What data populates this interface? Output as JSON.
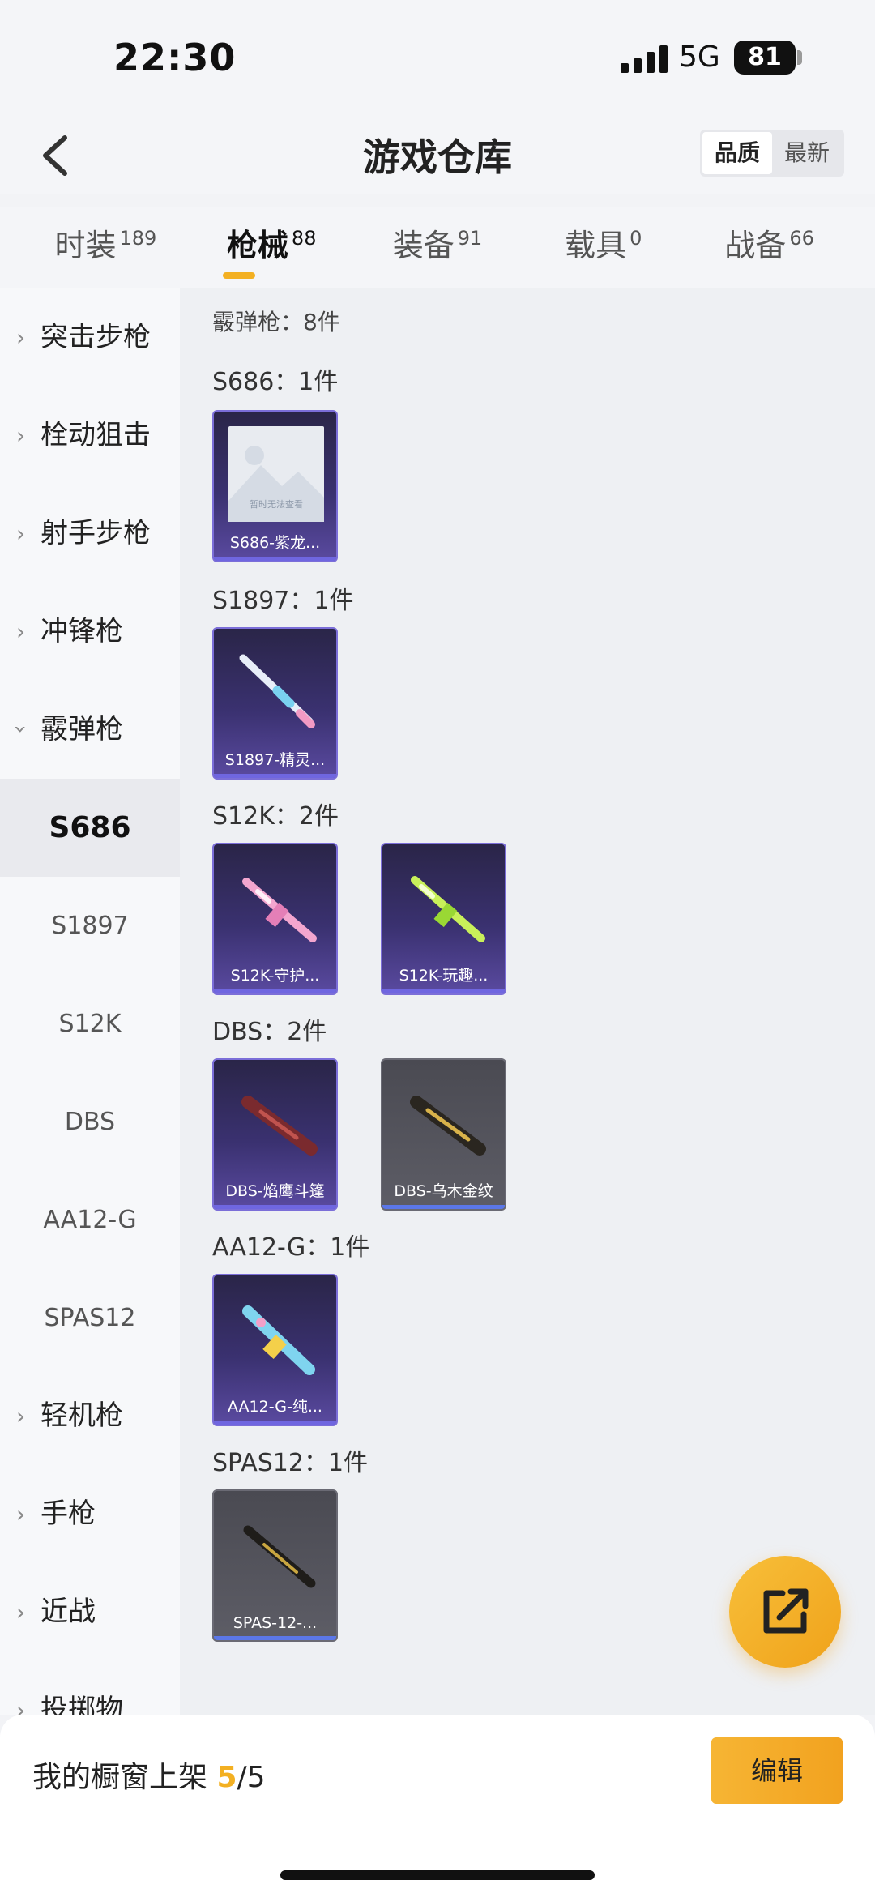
{
  "status_bar": {
    "time": "22:30",
    "network": "5G",
    "battery": "81"
  },
  "header": {
    "title": "游戏仓库",
    "sort_options": [
      "品质",
      "最新"
    ],
    "active_sort": "品质"
  },
  "tabs": [
    {
      "label": "时装",
      "count": "189"
    },
    {
      "label": "枪械",
      "count": "88"
    },
    {
      "label": "装备",
      "count": "91"
    },
    {
      "label": "载具",
      "count": "0"
    },
    {
      "label": "战备",
      "count": "66"
    }
  ],
  "sidebar": {
    "categories": [
      "突击步枪",
      "栓动狙击",
      "射手步枪",
      "冲锋枪",
      "霰弹枪"
    ],
    "subcategories": [
      "S686",
      "S1897",
      "S12K",
      "DBS",
      "AA12-G",
      "SPAS12"
    ],
    "categories_after": [
      "轻机枪",
      "手枪",
      "近战",
      "投掷物"
    ]
  },
  "content": {
    "section_title": "霰弹枪：8件",
    "groups": [
      {
        "title": "S686：1件",
        "items": [
          "S686-紫龙..."
        ],
        "placeholder_text": "暂时无法查看"
      },
      {
        "title": "S1897：1件",
        "items": [
          "S1897-精灵..."
        ]
      },
      {
        "title": "S12K：2件",
        "items": [
          "S12K-守护...",
          "S12K-玩趣..."
        ]
      },
      {
        "title": "DBS：2件",
        "items": [
          "DBS-焰鹰斗篷",
          "DBS-乌木金纹"
        ]
      },
      {
        "title": "AA12-G：1件",
        "items": [
          "AA12-G-纯..."
        ]
      },
      {
        "title": "SPAS12：1件",
        "items": [
          "SPAS-12-..."
        ]
      }
    ]
  },
  "bottom": {
    "showcase_label": "我的橱窗上架",
    "showcase_current": "5",
    "showcase_total": "/5",
    "edit_label": "编辑"
  },
  "colors": {
    "accent": "#f3b022",
    "card_purple": "#3a3170",
    "card_gray": "#5d5d66"
  }
}
